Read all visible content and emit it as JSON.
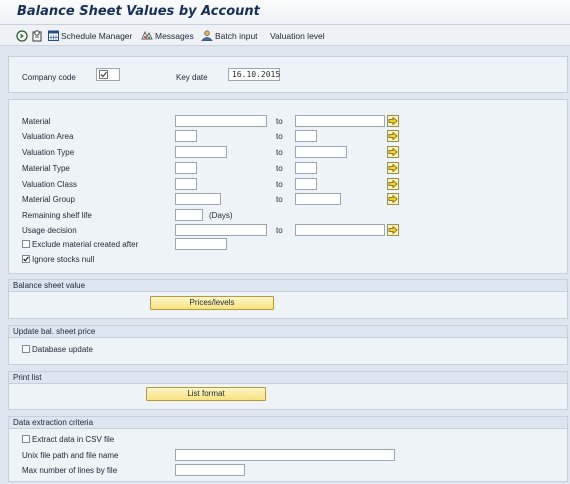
{
  "app_title": "Balance Sheet Values by Account",
  "toolbar": {
    "schedule_manager": "Schedule Manager",
    "messages": "Messages",
    "batch_input": "Batch input",
    "valuation_level": "Valuation level"
  },
  "header": {
    "company_code_label": "Company code",
    "key_date_label": "Key date",
    "key_date_value": "16.10.2015"
  },
  "selection": {
    "to_label": "to",
    "fields": [
      {
        "label": "Material"
      },
      {
        "label": "Valuation Area"
      },
      {
        "label": "Valuation Type"
      },
      {
        "label": "Material Type"
      },
      {
        "label": "Valuation Class"
      },
      {
        "label": "Material Group"
      },
      {
        "label": "Remaining shelf life"
      },
      {
        "label": "Usage decision"
      }
    ],
    "days_label": "(Days)",
    "exclude_label": "Exclude material created after",
    "exclude_checked": false,
    "ignore_label": "Ignore stocks null",
    "ignore_checked": true
  },
  "balance_sheet": {
    "title": "Balance sheet value",
    "button": "Prices/levels"
  },
  "update_price": {
    "title": "Update bal. sheet price",
    "db_update_label": "Database update",
    "db_update_checked": false
  },
  "print_list": {
    "title": "Print list",
    "button": "List format"
  },
  "extraction": {
    "title": "Data extraction criteria",
    "csv_label": "Extract data in CSV file",
    "csv_checked": false,
    "path_label": "Unix file path and file name",
    "maxlines_label": "Max number of lines by file"
  },
  "colors": {
    "background": "#dfe6ef",
    "title_text": "#16305b",
    "button_yellow": "#f9e27f"
  }
}
